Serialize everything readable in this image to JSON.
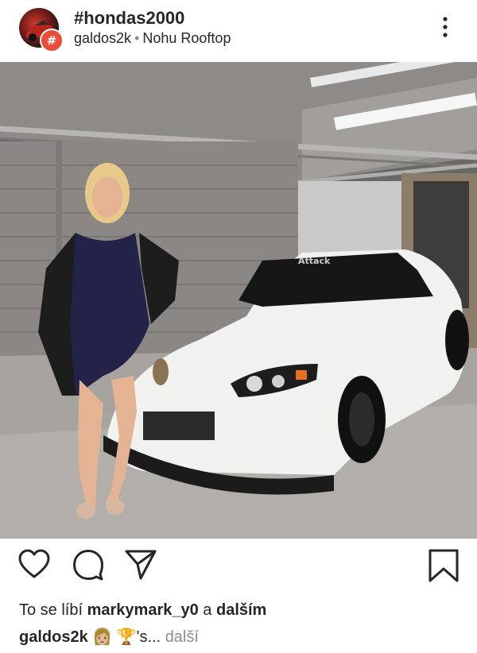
{
  "header": {
    "title": "#hondas2000",
    "username": "galdos2k",
    "separator": "•",
    "location": "Nohu Rooftop",
    "badge": "#"
  },
  "photo": {
    "description_icon": "car-photo",
    "windshield_text": "Attack"
  },
  "actions": {
    "like_icon": "heart-icon",
    "comment_icon": "comment-icon",
    "share_icon": "send-icon",
    "save_icon": "bookmark-icon"
  },
  "likes": {
    "prefix": "To se líbí ",
    "user": "markymark_y0",
    "middle": " a ",
    "others": "dalším"
  },
  "caption": {
    "user": "galdos2k",
    "emoji1": "👩🏼",
    "emoji2": "🏆",
    "text": "'s... ",
    "more": "další"
  },
  "colors": {
    "badge": "#ea4c3c",
    "text": "#262626",
    "muted": "#8e8e8e"
  }
}
